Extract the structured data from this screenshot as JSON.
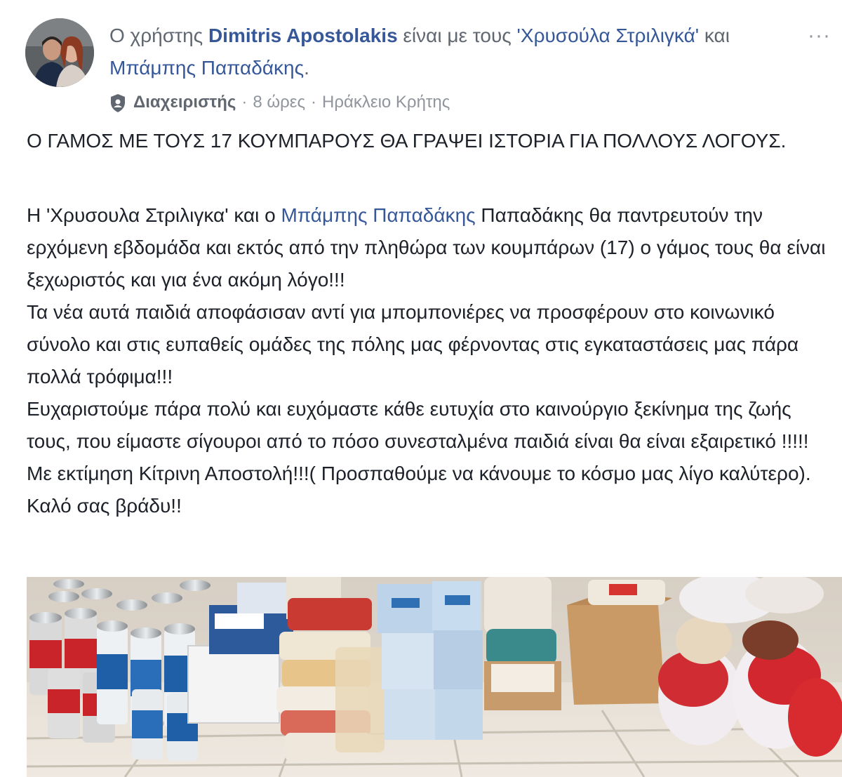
{
  "header": {
    "prefix": "Ο χρήστης ",
    "author": "Dimitris Apostolakis",
    "with_text": " είναι με τους ",
    "tagged_1": "'Χρυσούλα Στριλιγκά'",
    "and_text": " και ",
    "tagged_2": "Μπάμπης Παπαδάκης",
    "suffix": ".",
    "menu_label": "···"
  },
  "meta": {
    "role": "Διαχειριστής",
    "separator": "·",
    "time": "8 ώρες",
    "location": "Ηράκλειο Κρήτης",
    "icon": "admin-shield-icon"
  },
  "post": {
    "headline": "Ο ΓΑΜΟΣ ΜΕ ΤΟΥΣ 17 ΚΟΥΜΠΑΡΟΥΣ ΘΑ ΓΡΑΨΕΙ ΙΣΤΟΡΙΑ ΓΙΑ ΠΟΛΛΟΥΣ ΛΟΓΟΥΣ.",
    "p1_start": "Η 'Χρυσουλα Στριλιγκα' και ο ",
    "p1_link": "Μπάμπης Παπαδάκης",
    "p1_rest": " Παπαδάκης θα παντρευτούν την ερχόμενη εβδομάδα και εκτός από την πληθώρα των κουμπάρων (17) ο γάμος τους θα είναι ξεχωριστός και για ένα ακόμη λόγο!!!",
    "p2": "Τα νέα αυτά παιδιά αποφάσισαν αντί για μπομπονιέρες να προσφέρουν στο κοινωνικό σύνολο και στις ευπαθείς ομάδες της πόλης μας φέρνοντας στις εγκαταστάσεις μας πάρα πολλά τρόφιμα!!!",
    "p3": "Ευχαριστούμε πάρα πολύ και ευχόμαστε κάθε ευτυχία στο καινούργιο ξεκίνημα της ζωής τους, που είμαστε σίγουροι από το πόσο συνεσταλμένα παιδιά είναι θα είναι εξαιρετικό !!!!!",
    "p4": "Με εκτίμηση Κίτρινη Αποστολή!!!( Προσπαθούμε να κάνουμε το κόσμο μας λίγο καλύτερο). Καλό σας βράδυ!!"
  },
  "colors": {
    "link": "#365899",
    "meta_gray": "#90949c",
    "text": "#1d2129",
    "sauce_red": "#c8242a",
    "tile_beige": "#e5ddd2"
  }
}
